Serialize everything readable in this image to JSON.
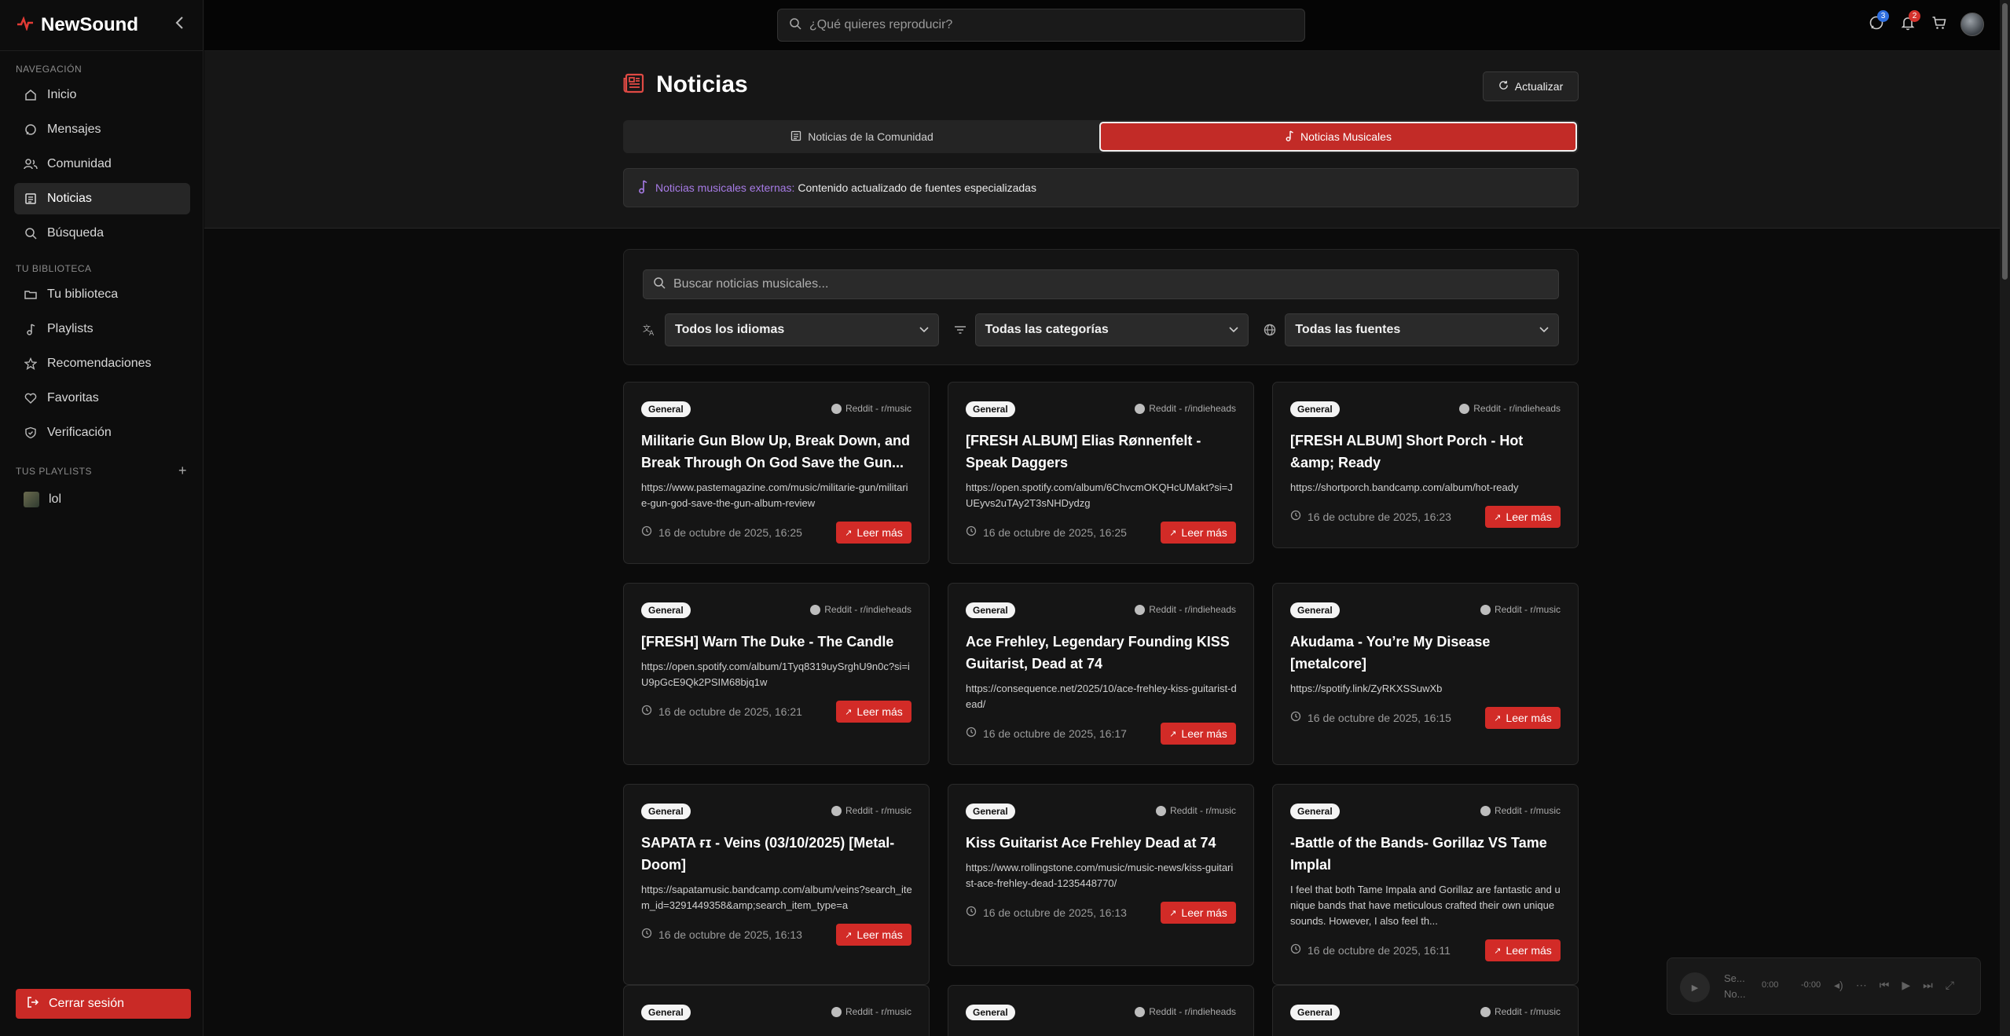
{
  "brand": {
    "name": "NewSound"
  },
  "sidebar": {
    "nav_title": "NAVEGACIÓN",
    "nav_items": [
      {
        "label": "Inicio",
        "icon": "home-icon"
      },
      {
        "label": "Mensajes",
        "icon": "message-icon"
      },
      {
        "label": "Comunidad",
        "icon": "users-icon"
      },
      {
        "label": "Noticias",
        "icon": "newspaper-icon",
        "active": true
      },
      {
        "label": "Búsqueda",
        "icon": "search-icon"
      }
    ],
    "library_title": "TU BIBLIOTECA",
    "library_items": [
      {
        "label": "Tu biblioteca",
        "icon": "folder-icon"
      },
      {
        "label": "Playlists",
        "icon": "music-note-icon"
      },
      {
        "label": "Recomendaciones",
        "icon": "star-icon"
      },
      {
        "label": "Favoritas",
        "icon": "heart-icon"
      },
      {
        "label": "Verificación",
        "icon": "shield-check-icon"
      }
    ],
    "playlists_title": "TUS PLAYLISTS",
    "playlists": [
      {
        "label": "lol"
      }
    ],
    "logout_label": "Cerrar sesión"
  },
  "topbar": {
    "search_placeholder": "¿Qué quieres reproducir?",
    "messages_badge": "3",
    "notifications_badge": "2"
  },
  "page": {
    "title": "Noticias",
    "refresh_label": "Actualizar",
    "tabs": [
      {
        "label": "Noticias de la Comunidad",
        "active": false
      },
      {
        "label": "Noticias Musicales",
        "active": true
      }
    ],
    "banner_accent": "Noticias musicales externas:",
    "banner_text": "Contenido actualizado de fuentes especializadas"
  },
  "filters": {
    "search_placeholder": "Buscar noticias musicales...",
    "language": "Todos los idiomas",
    "category": "Todas las categorías",
    "source": "Todas las fuentes"
  },
  "cards": [
    {
      "tag": "General",
      "source": "Reddit - r/music",
      "title": "Militarie Gun Blow Up, Break Down, and Break Through On God Save the Gun...",
      "desc": "https://www.pastemagazine.com/music/militarie-gun/militarie-gun-god-save-the-gun-album-review",
      "date": "16 de octubre de 2025, 16:25",
      "read": "Leer más"
    },
    {
      "tag": "General",
      "source": "Reddit - r/indieheads",
      "title": "[FRESH ALBUM] Elias Rønnenfelt - Speak Daggers",
      "desc": "https://open.spotify.com/album/6ChvcmOKQHcUMakt?si=JUEyvs2uTAy2T3sNHDydzg",
      "date": "16 de octubre de 2025, 16:25",
      "read": "Leer más"
    },
    {
      "tag": "General",
      "source": "Reddit - r/indieheads",
      "title": "[FRESH ALBUM] Short Porch - Hot &amp; Ready",
      "desc": "https://shortporch.bandcamp.com/album/hot-ready",
      "date": "16 de octubre de 2025, 16:23",
      "read": "Leer más"
    },
    {
      "tag": "General",
      "source": "Reddit - r/indieheads",
      "title": "[FRESH] Warn The Duke - The Candle",
      "desc": "https://open.spotify.com/album/1Tyq8319uySrghU9n0c?si=iU9pGcE9Qk2PSIM68bjq1w",
      "date": "16 de octubre de 2025, 16:21",
      "read": "Leer más"
    },
    {
      "tag": "General",
      "source": "Reddit - r/indieheads",
      "title": "Ace Frehley, Legendary Founding KISS Guitarist, Dead at 74",
      "desc": "https://consequence.net/2025/10/ace-frehley-kiss-guitarist-dead/",
      "date": "16 de octubre de 2025, 16:17",
      "read": "Leer más"
    },
    {
      "tag": "General",
      "source": "Reddit - r/music",
      "title": "Akudama - You’re My Disease [metalcore]",
      "desc": "https://spotify.link/ZyRKXSSuwXb",
      "date": "16 de octubre de 2025, 16:15",
      "read": "Leer más"
    },
    {
      "tag": "General",
      "source": "Reddit - r/music",
      "title": "SAPATA ғɪ - Veins (03/10/2025) [Metal-Doom]",
      "desc": "https://sapatamusic.bandcamp.com/album/veins?search_item_id=3291449358&amp;search_item_type=a",
      "date": "16 de octubre de 2025, 16:13",
      "read": "Leer más"
    },
    {
      "tag": "General",
      "source": "Reddit - r/music",
      "title": "Kiss Guitarist Ace Frehley Dead at 74",
      "desc": "https://www.rollingstone.com/music/music-news/kiss-guitarist-ace-frehley-dead-1235448770/",
      "date": "16 de octubre de 2025, 16:13",
      "read": "Leer más"
    },
    {
      "tag": "General",
      "source": "Reddit - r/music",
      "title": "-Battle of the Bands- Gorillaz VS Tame Implal",
      "desc": "I feel that both Tame Impala and Gorillaz are fantastic and unique bands that have meticulous crafted their own unique sounds. However, I also feel th...",
      "date": "16 de octubre de 2025, 16:11",
      "read": "Leer más"
    },
    {
      "tag": "General",
      "source": "Reddit - r/music",
      "title": "",
      "desc": "",
      "date": "",
      "read": ""
    },
    {
      "tag": "General",
      "source": "Reddit - r/indieheads",
      "title": "",
      "desc": "",
      "date": "",
      "read": ""
    },
    {
      "tag": "General",
      "source": "Reddit - r/music",
      "title": "",
      "desc": "",
      "date": "",
      "read": ""
    }
  ],
  "player": {
    "title": "Se...",
    "subtitle": "No...",
    "elapsed": "0:00",
    "remaining": "-0:00"
  }
}
